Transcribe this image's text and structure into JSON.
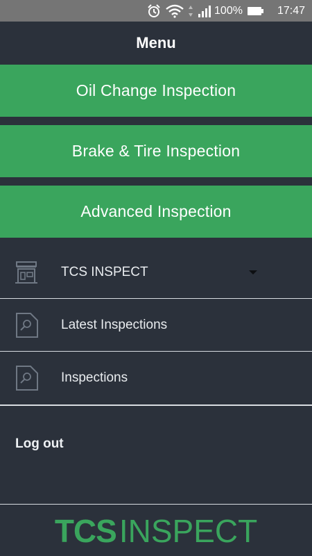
{
  "status_bar": {
    "battery_percent": "100%",
    "time": "17:47",
    "icons": [
      "alarm-icon",
      "wifi-icon",
      "signal-icon",
      "battery-icon"
    ]
  },
  "header": {
    "title": "Menu"
  },
  "inspection_buttons": [
    {
      "label": "Oil Change Inspection"
    },
    {
      "label": "Brake & Tire Inspection"
    },
    {
      "label": "Advanced Inspection"
    }
  ],
  "menu": {
    "items": [
      {
        "label": "TCS INSPECT",
        "icon": "storefront-icon",
        "has_dropdown": true
      },
      {
        "label": "Latest Inspections",
        "icon": "document-search-icon"
      },
      {
        "label": "Inspections",
        "icon": "document-search-icon"
      }
    ]
  },
  "logout": {
    "label": "Log out"
  },
  "footer": {
    "logo_bold": "TCS",
    "logo_light": "INSPECT"
  },
  "colors": {
    "accent": "#3aa55d",
    "background": "#2b313b",
    "status_bar": "#757575",
    "divider": "#d9dde2"
  }
}
